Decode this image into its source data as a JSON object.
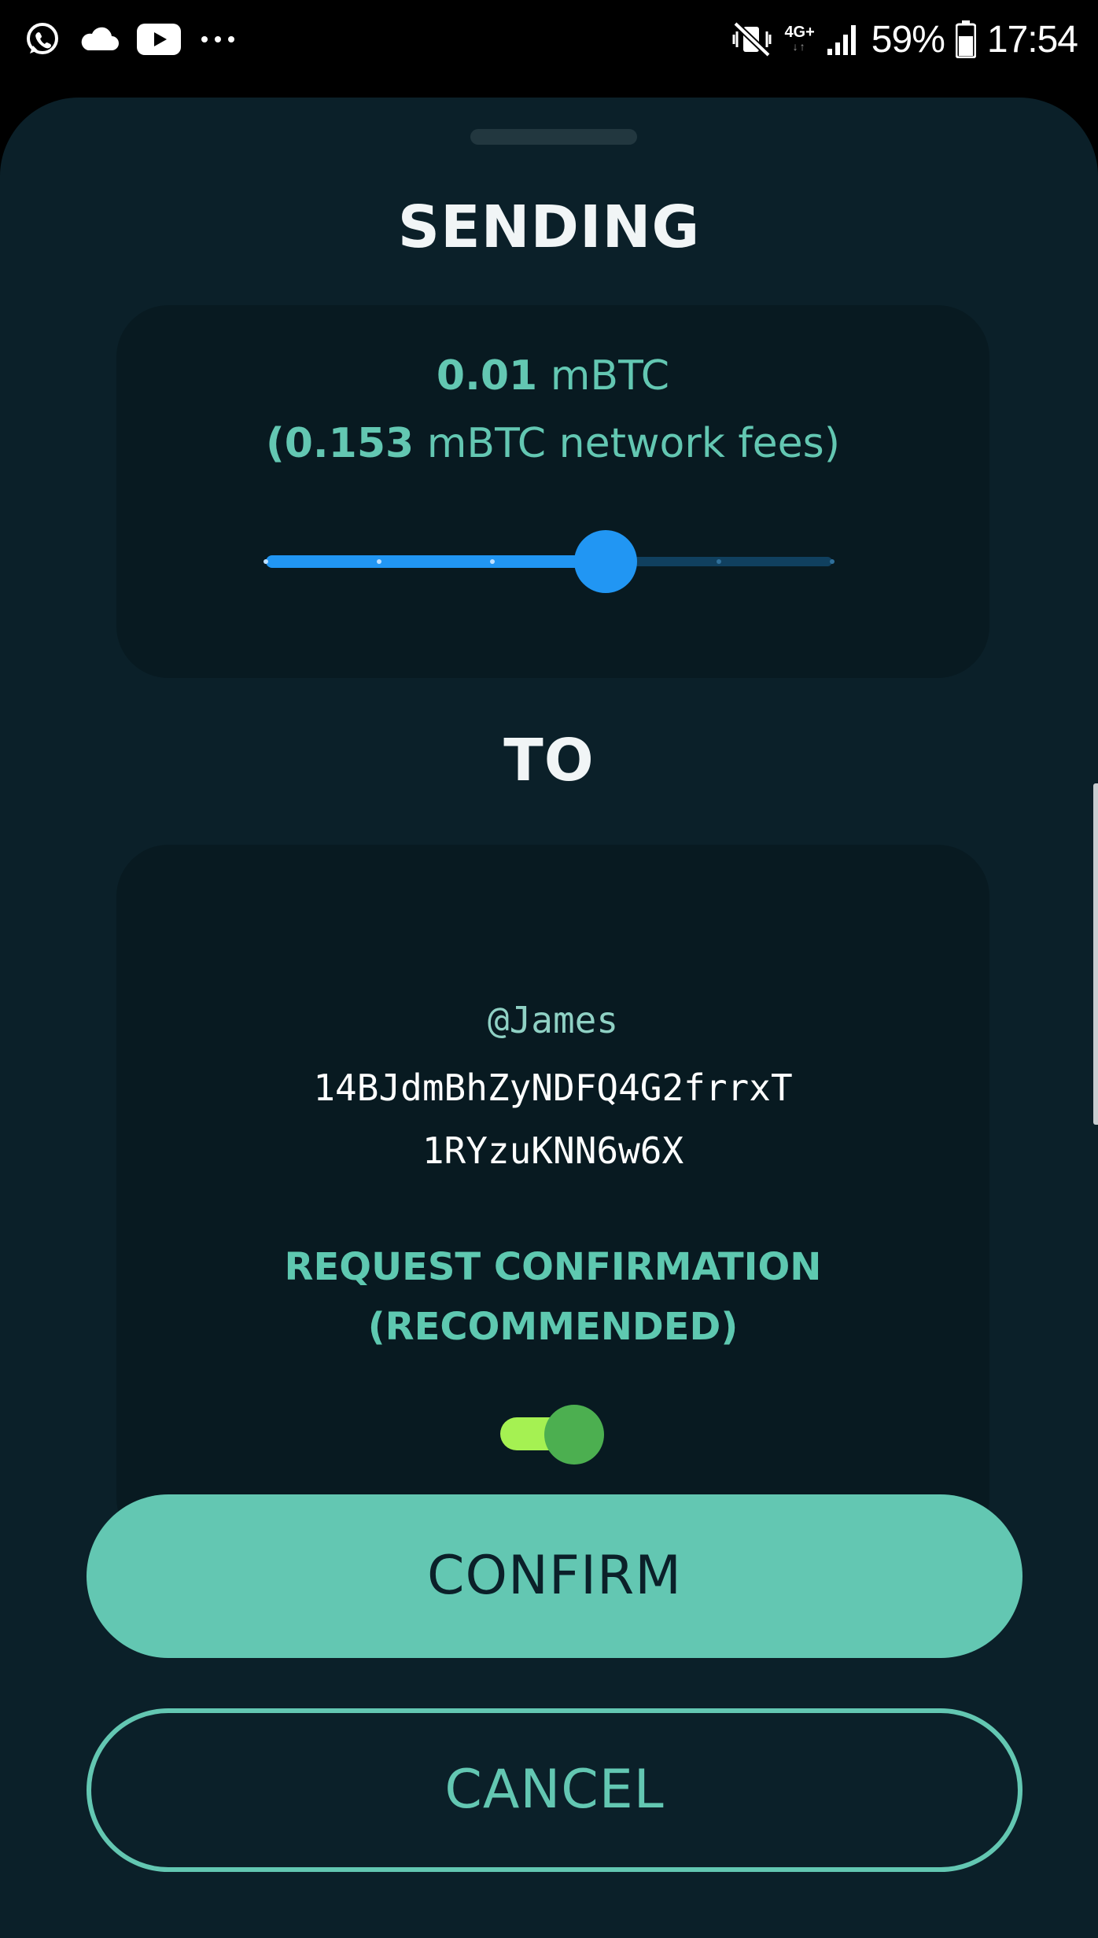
{
  "status_bar": {
    "left_icons": [
      "whatsapp-icon",
      "cloud-icon",
      "youtube-icon",
      "more-dots-icon"
    ],
    "network_type": "4G+",
    "battery_percent": "59%",
    "time": "17:54",
    "right_icons": [
      "mute-vibrate-icon",
      "data-arrows-icon",
      "signal-icon",
      "battery-icon"
    ]
  },
  "sheet": {
    "sending_title": "SENDING",
    "amount": {
      "value": "0.01",
      "unit": "mBTC",
      "fee_open": "(",
      "fee_value": "0.153",
      "fee_text": "mBTC network fees)"
    },
    "fee_slider": {
      "steps": 6,
      "selected_step": 3,
      "fill_fraction": 0.6
    },
    "to_title": "TO",
    "recipient": {
      "name": "@James",
      "address_line_1": "14BJdmBhZyNDFQ4G2frrxT",
      "address_line_2": "1RYzuKNN6w6X"
    },
    "request_confirmation": {
      "line_1": "REQUEST CONFIRMATION",
      "line_2": "(RECOMMENDED)",
      "enabled": true
    },
    "buttons": {
      "confirm": "CONFIRM",
      "cancel": "CANCEL"
    }
  },
  "colors": {
    "sheet_bg": "#0b2029",
    "card_bg": "#081a21",
    "accent": "#63c7b2",
    "slider_blue": "#2196f3",
    "toggle_track": "#a5f152",
    "toggle_thumb": "#4caf50"
  }
}
